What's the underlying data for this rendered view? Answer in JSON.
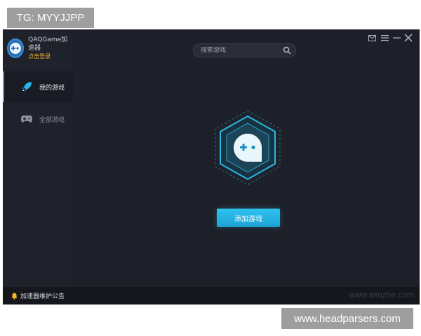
{
  "overlay": {
    "tag": "TG: MYYJJPP",
    "url": "www.headparsers.com"
  },
  "app": {
    "title": "QAQGame加速器",
    "login_link": "点击登录",
    "search": {
      "placeholder": "搜索游戏"
    },
    "nav": [
      {
        "label": "我的游戏",
        "icon": "rocket-icon",
        "active": true
      },
      {
        "label": "全部游戏",
        "icon": "gamepad-icon",
        "active": false
      }
    ],
    "add_game_button": "添加游戏",
    "footer_notice": "加速器维护公告",
    "watermark": "www.wmzhe.com",
    "colors": {
      "background": "#1e2029",
      "sidebar": "#20222b",
      "accent": "#26b7e6",
      "login": "#f2b530",
      "footer": "#15171d"
    }
  }
}
